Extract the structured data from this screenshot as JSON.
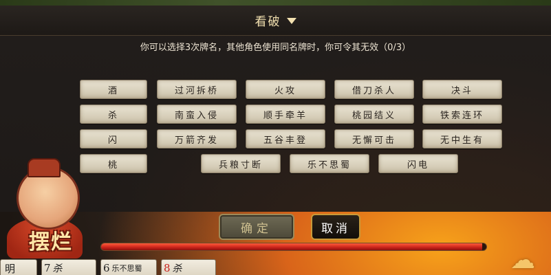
{
  "modal": {
    "title": "看破",
    "instruction": "你可以选择3次牌名，其他角色使用同名牌时，你可令其无效（0/3）"
  },
  "cards": {
    "row1": [
      "酒",
      "过河拆桥",
      "火攻",
      "借刀杀人",
      "决斗"
    ],
    "row2": [
      "杀",
      "南蛮入侵",
      "顺手牵羊",
      "桃园结义",
      "铁索连环"
    ],
    "row3": [
      "闪",
      "万箭齐发",
      "五谷丰登",
      "无懈可击",
      "无中生有"
    ],
    "row4": [
      "桃",
      "兵粮寸断",
      "乐不思蜀",
      "闪电"
    ]
  },
  "avatar": {
    "label_1": "摆",
    "label_2": "烂"
  },
  "buttons": {
    "confirm": "确定",
    "cancel": "取消"
  },
  "timer": {
    "progress_fraction": 0.99
  },
  "hand": [
    {
      "num": "",
      "name": "明",
      "suit": ""
    },
    {
      "num": "7",
      "name": "",
      "suit": "杀"
    },
    {
      "num": "6",
      "name": "乐不思蜀",
      "suit": ""
    },
    {
      "num": "8",
      "name": "",
      "suit": "杀"
    }
  ],
  "colors": {
    "accent": "#c8201a",
    "title": "#f3e1b0"
  }
}
